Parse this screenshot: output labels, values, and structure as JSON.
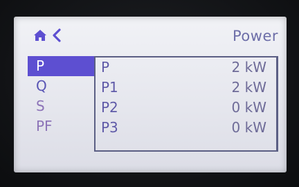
{
  "header": {
    "title": "Power"
  },
  "menu": {
    "items": [
      {
        "label": "P"
      },
      {
        "label": "Q"
      },
      {
        "label": "S"
      },
      {
        "label": "PF"
      }
    ]
  },
  "panel": {
    "rows": [
      {
        "name": "P",
        "value": "2 kW"
      },
      {
        "name": "P1",
        "value": "2 kW"
      },
      {
        "name": "P2",
        "value": "0 kW"
      },
      {
        "name": "P3",
        "value": "0 kW"
      }
    ]
  },
  "colors": {
    "accent": "#5d4fd1",
    "text": "#5f5aa8",
    "screen": "#e8e9ef",
    "bezel": "#111214"
  },
  "icons": [
    "home-icon",
    "back-icon"
  ]
}
